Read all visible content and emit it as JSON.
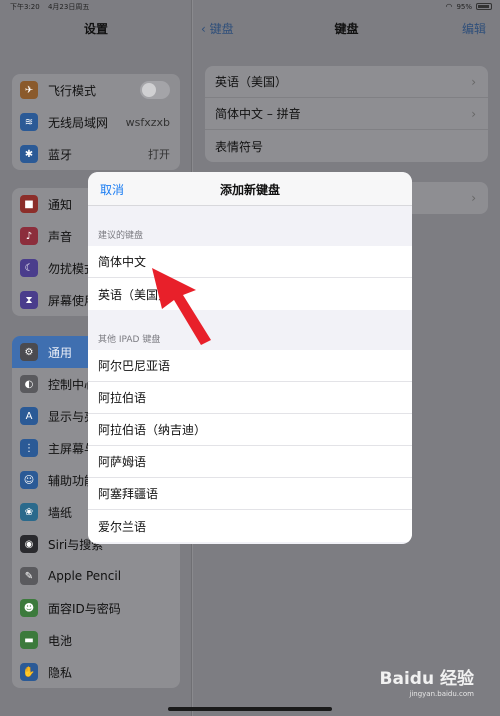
{
  "status_bar": {
    "time": "下午3:20",
    "date": "4月23日周五",
    "battery": "95%"
  },
  "sidebar": {
    "title": "设置",
    "groups": [
      [
        {
          "label": "飞行模式",
          "icon": "airplane-icon",
          "color": "#8a5a2c",
          "glyph": "✈",
          "toggle": true
        },
        {
          "label": "无线局域网",
          "icon": "wifi-icon",
          "color": "#2b5a96",
          "glyph": "≋",
          "value": "wsfxzxb"
        },
        {
          "label": "蓝牙",
          "icon": "bluetooth-icon",
          "color": "#2b5a96",
          "glyph": "✱",
          "value": "打开"
        }
      ],
      [
        {
          "label": "通知",
          "icon": "notifications-icon",
          "color": "#8c2e2a",
          "glyph": "■"
        },
        {
          "label": "声音",
          "icon": "sound-icon",
          "color": "#8c2e3c",
          "glyph": "♪"
        },
        {
          "label": "勿扰模式",
          "icon": "moon-icon",
          "color": "#4a3d8c",
          "glyph": "☾"
        },
        {
          "label": "屏幕使用时间",
          "icon": "hourglass-icon",
          "color": "#4a3d8c",
          "glyph": "⧗"
        }
      ],
      [
        {
          "label": "通用",
          "icon": "gear-icon",
          "color": "#4b4b50",
          "glyph": "⚙",
          "selected": true
        },
        {
          "label": "控制中心",
          "icon": "control-center-icon",
          "color": "#5a5a5e",
          "glyph": "◐"
        },
        {
          "label": "显示与亮度",
          "icon": "display-icon",
          "color": "#2b5a96",
          "glyph": "A"
        },
        {
          "label": "主屏幕与程序坞",
          "icon": "home-screen-icon",
          "color": "#2b5a96",
          "glyph": "⋮"
        },
        {
          "label": "辅助功能",
          "icon": "accessibility-icon",
          "color": "#2b5a96",
          "glyph": "☺"
        },
        {
          "label": "墙纸",
          "icon": "wallpaper-icon",
          "color": "#2b6a8c",
          "glyph": "❀"
        },
        {
          "label": "Siri与搜索",
          "icon": "siri-icon",
          "color": "#2a2a2e",
          "glyph": "◉"
        },
        {
          "label": "Apple Pencil",
          "icon": "pencil-icon",
          "color": "#5a5a5e",
          "glyph": "✎"
        },
        {
          "label": "面容ID与密码",
          "icon": "face-id-icon",
          "color": "#3c7a3c",
          "glyph": "☻"
        },
        {
          "label": "电池",
          "icon": "battery-icon",
          "color": "#3c7a3c",
          "glyph": "▬"
        },
        {
          "label": "隐私",
          "icon": "hand-icon",
          "color": "#2b5a96",
          "glyph": "✋"
        }
      ]
    ]
  },
  "main": {
    "back_label": "键盘",
    "title": "键盘",
    "edit_label": "编辑",
    "keyboards": [
      "英语（美国）",
      "简体中文 – 拼音",
      "表情符号"
    ]
  },
  "modal": {
    "cancel_label": "取消",
    "title": "添加新键盘",
    "suggested_header": "建议的键盘",
    "suggested": [
      "简体中文",
      "英语（美国）"
    ],
    "other_header": "其他 IPAD 键盘",
    "others": [
      "阿尔巴尼亚语",
      "阿拉伯语",
      "阿拉伯语（纳吉迪）",
      "阿萨姆语",
      "阿塞拜疆语",
      "爱尔兰语"
    ]
  },
  "watermark": {
    "brand": "Baidu 经验",
    "url": "jingyan.baidu.com"
  },
  "colors": {
    "accent": "#1a7cf2",
    "arrow": "#e8202a",
    "selected_row": "#3f6fb0"
  }
}
